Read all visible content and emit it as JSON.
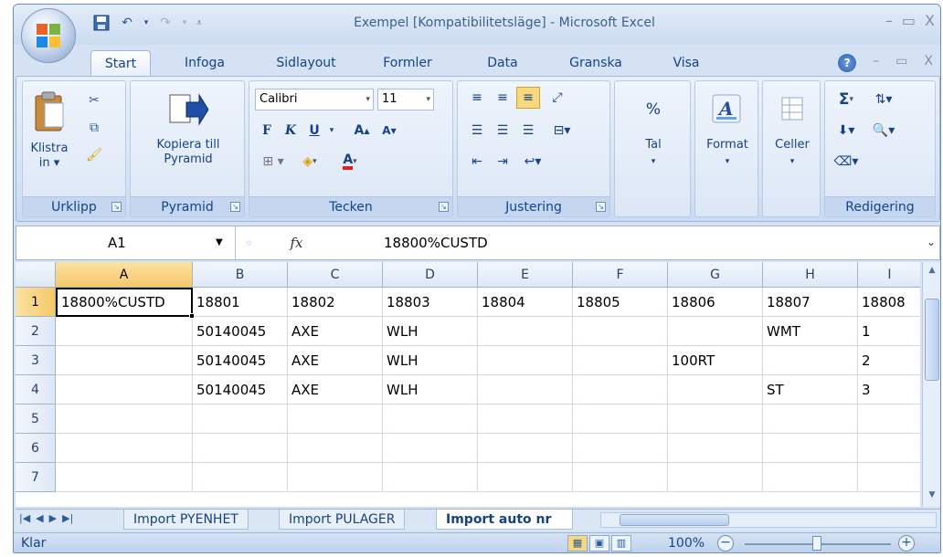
{
  "title_bar": {
    "title": "Exempel [Kompatibilitetsläge] - Microsoft Excel",
    "qat": [
      "save-icon",
      "undo-icon",
      "redo-icon",
      "customize-icon"
    ]
  },
  "tabs": [
    "Start",
    "Infoga",
    "Sidlayout",
    "Formler",
    "Data",
    "Granska",
    "Visa"
  ],
  "active_tab": "Start",
  "ribbon": {
    "clipboard": {
      "paste_label": "Klistra\nin ▾",
      "group_label": "Urklipp"
    },
    "pyramid": {
      "button_label": "Kopiera till\nPyramid",
      "group_label": "Pyramid"
    },
    "font": {
      "font_name": "Calibri",
      "font_size": "11",
      "bold": "F",
      "italic": "K",
      "underline": "U",
      "group_label": "Tecken"
    },
    "alignment": {
      "group_label": "Justering"
    },
    "number": {
      "label": "Tal",
      "symbol": "%"
    },
    "styles": {
      "label": "Format"
    },
    "cells": {
      "label": "Celler"
    },
    "editing": {
      "group_label": "Redigering",
      "sum_symbol": "Σ"
    }
  },
  "formula_bar": {
    "name_box": "A1",
    "fx": "fx",
    "content": "18800%CUSTD"
  },
  "grid": {
    "columns": [
      "A",
      "B",
      "C",
      "D",
      "E",
      "F",
      "G",
      "H",
      "I"
    ],
    "rows": [
      "1",
      "2",
      "3",
      "4",
      "5",
      "6",
      "7"
    ],
    "cells": [
      [
        "18800%CUSTD",
        "18801",
        "18802",
        "18803",
        "18804",
        "18805",
        "18806",
        "18807",
        "18808"
      ],
      [
        "",
        "50140045",
        "AXE",
        "WLH",
        "",
        "",
        "",
        "WMT",
        "1"
      ],
      [
        "",
        "50140045",
        "AXE",
        "WLH",
        "",
        "",
        "100RT",
        "",
        "2"
      ],
      [
        "",
        "50140045",
        "AXE",
        "WLH",
        "",
        "",
        "",
        "ST",
        "3"
      ],
      [
        "",
        "",
        "",
        "",
        "",
        "",
        "",
        "",
        ""
      ],
      [
        "",
        "",
        "",
        "",
        "",
        "",
        "",
        "",
        ""
      ],
      [
        "",
        "",
        "",
        "",
        "",
        "",
        "",
        "",
        ""
      ]
    ],
    "active_cell": "A1"
  },
  "sheet_tabs": [
    "Import PYENHET",
    "Import PULAGER",
    "Import auto nr"
  ],
  "active_sheet": "Import auto nr",
  "status_bar": {
    "status": "Klar",
    "zoom": "100%"
  },
  "colors": {
    "accent": "#15428b",
    "ribbon_bg": "#d6e3f4",
    "selected_header": "#f6c869"
  }
}
